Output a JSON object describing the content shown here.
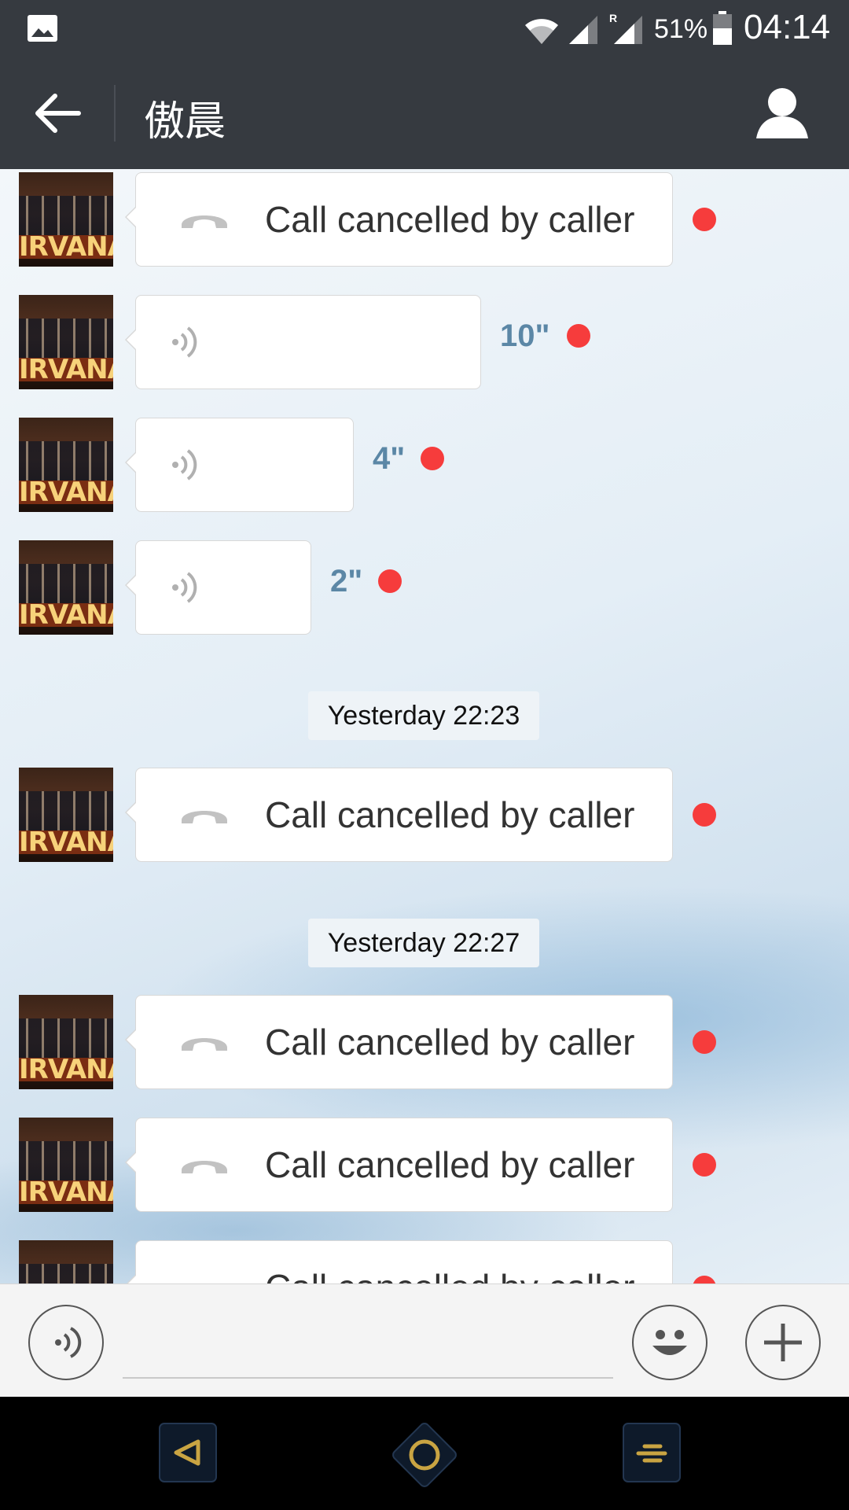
{
  "status_bar": {
    "battery_percent": "51%",
    "time": "04:14",
    "roaming_indicator": "R",
    "icons": [
      "gallery-icon",
      "wifi-icon",
      "signal-icon",
      "signal-roaming-icon",
      "battery-icon"
    ]
  },
  "header": {
    "title": "傲晨",
    "back_icon": "arrow-left-icon",
    "profile_icon": "person-icon"
  },
  "avatar": {
    "sign_text": "IRVANA"
  },
  "messages": [
    {
      "type": "call",
      "text": "Call cancelled by caller",
      "unread": true
    },
    {
      "type": "voice",
      "duration": "10\"",
      "unread": true
    },
    {
      "type": "voice",
      "duration": "4\"",
      "unread": true
    },
    {
      "type": "voice",
      "duration": "2\"",
      "unread": true
    },
    {
      "type": "timestamp",
      "text": "Yesterday 22:23"
    },
    {
      "type": "call",
      "text": "Call cancelled by caller",
      "unread": true
    },
    {
      "type": "timestamp",
      "text": "Yesterday 22:27"
    },
    {
      "type": "call",
      "text": "Call cancelled by caller",
      "unread": true
    },
    {
      "type": "call",
      "text": "Call cancelled by caller",
      "unread": true
    },
    {
      "type": "call",
      "text": "Call cancelled by caller",
      "unread": true
    }
  ],
  "input_bar": {
    "voice_toggle_icon": "voice-input-icon",
    "emoji_icon": "emoji-icon",
    "more_icon": "plus-icon",
    "text_value": ""
  },
  "nav_bar": {
    "icons": [
      "nav-back-icon",
      "nav-home-icon",
      "nav-menu-icon"
    ]
  },
  "colors": {
    "header_bg": "#363a40",
    "unread_dot": "#f63c3c",
    "duration_text": "#5b87a6",
    "nav_accent": "#c9a442"
  }
}
